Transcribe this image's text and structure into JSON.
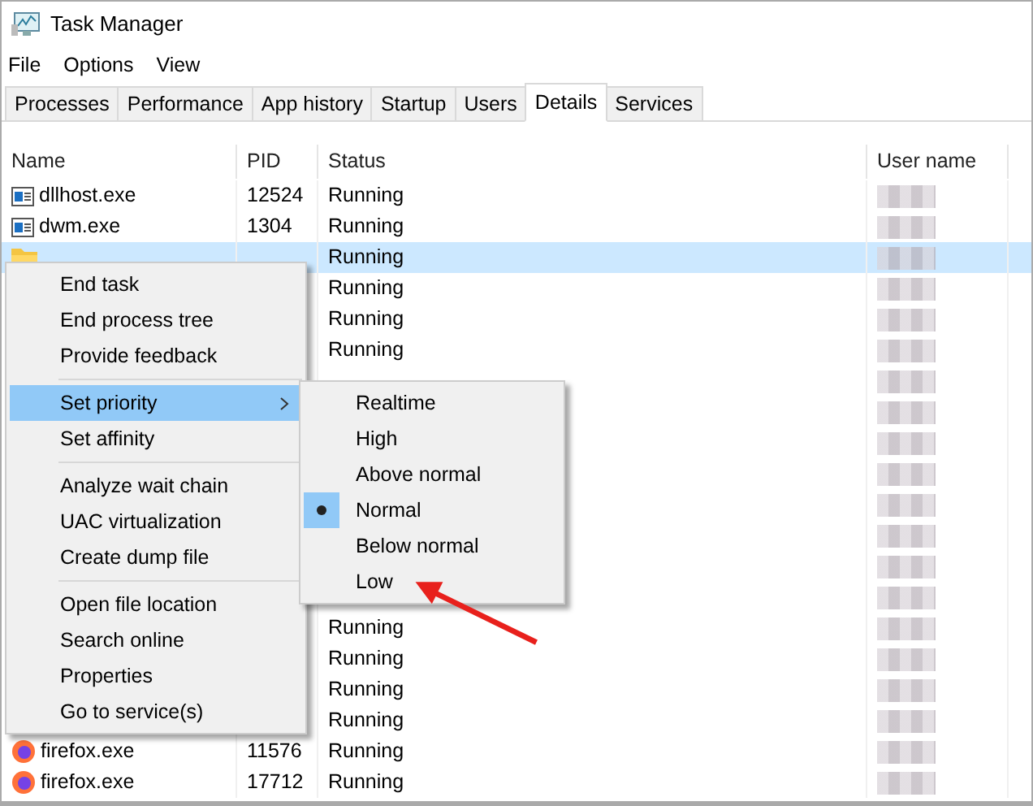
{
  "window": {
    "title": "Task Manager"
  },
  "menu_bar": [
    "File",
    "Options",
    "View"
  ],
  "tabs": [
    {
      "label": "Processes",
      "selected": false
    },
    {
      "label": "Performance",
      "selected": false
    },
    {
      "label": "App history",
      "selected": false
    },
    {
      "label": "Startup",
      "selected": false
    },
    {
      "label": "Users",
      "selected": false
    },
    {
      "label": "Details",
      "selected": true
    },
    {
      "label": "Services",
      "selected": false
    }
  ],
  "table": {
    "columns": [
      "Name",
      "PID",
      "Status",
      "User name"
    ],
    "rows": [
      {
        "kind": "app",
        "name": "dllhost.exe",
        "pid": "12524",
        "status": "Running",
        "selected": false
      },
      {
        "kind": "app",
        "name": "dwm.exe",
        "pid": "1304",
        "status": "Running",
        "selected": false
      },
      {
        "kind": "folder",
        "status": "Running",
        "selected": true
      },
      {
        "status": "Running",
        "selected": false
      },
      {
        "status": "Running",
        "selected": false
      },
      {
        "status": "Running",
        "selected": false
      },
      {
        "selected": false
      },
      {
        "selected": false
      },
      {
        "selected": false
      },
      {
        "selected": false
      },
      {
        "selected": false
      },
      {
        "selected": false
      },
      {
        "selected": false
      },
      {
        "selected": false
      },
      {
        "status": "Running",
        "selected": false
      },
      {
        "status": "Running",
        "selected": false
      },
      {
        "status": "Running",
        "selected": false
      },
      {
        "status": "Running",
        "selected": false
      },
      {
        "kind": "firefox",
        "name": "firefox.exe",
        "pid": "11576",
        "status": "Running",
        "selected": false
      },
      {
        "kind": "firefox",
        "name": "firefox.exe",
        "pid": "17712",
        "status": "Running",
        "selected": false
      }
    ]
  },
  "context_menu": {
    "items": [
      {
        "kind": "item",
        "label": "End task",
        "selected": false
      },
      {
        "kind": "item",
        "label": "End process tree",
        "selected": false
      },
      {
        "kind": "item",
        "label": "Provide feedback",
        "selected": false
      },
      {
        "kind": "separator"
      },
      {
        "kind": "submenu",
        "label": "Set priority",
        "selected": true
      },
      {
        "kind": "item",
        "label": "Set affinity",
        "selected": false
      },
      {
        "kind": "separator"
      },
      {
        "kind": "item",
        "label": "Analyze wait chain",
        "selected": false
      },
      {
        "kind": "item",
        "label": "UAC virtualization",
        "selected": false
      },
      {
        "kind": "item",
        "label": "Create dump file",
        "selected": false
      },
      {
        "kind": "separator"
      },
      {
        "kind": "item",
        "label": "Open file location",
        "selected": false
      },
      {
        "kind": "item",
        "label": "Search online",
        "selected": false
      },
      {
        "kind": "item",
        "label": "Properties",
        "selected": false
      },
      {
        "kind": "item",
        "label": "Go to service(s)",
        "selected": false
      }
    ]
  },
  "priority_submenu": {
    "items": [
      {
        "label": "Realtime",
        "checked": false
      },
      {
        "label": "High",
        "checked": false
      },
      {
        "label": "Above normal",
        "checked": false
      },
      {
        "label": "Normal",
        "checked": true
      },
      {
        "label": "Below normal",
        "checked": false
      },
      {
        "label": "Low",
        "checked": false
      }
    ]
  }
}
